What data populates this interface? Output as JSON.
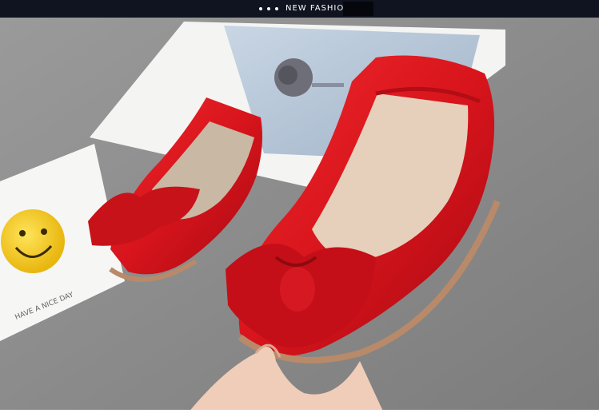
{
  "banner": {
    "title": "NEW FASHION",
    "background": "#0f1420"
  },
  "photo": {
    "background_color": "#8a8a8a",
    "accent_red": "#d8141c",
    "card_caption": "HAVE A NICE DAY"
  }
}
